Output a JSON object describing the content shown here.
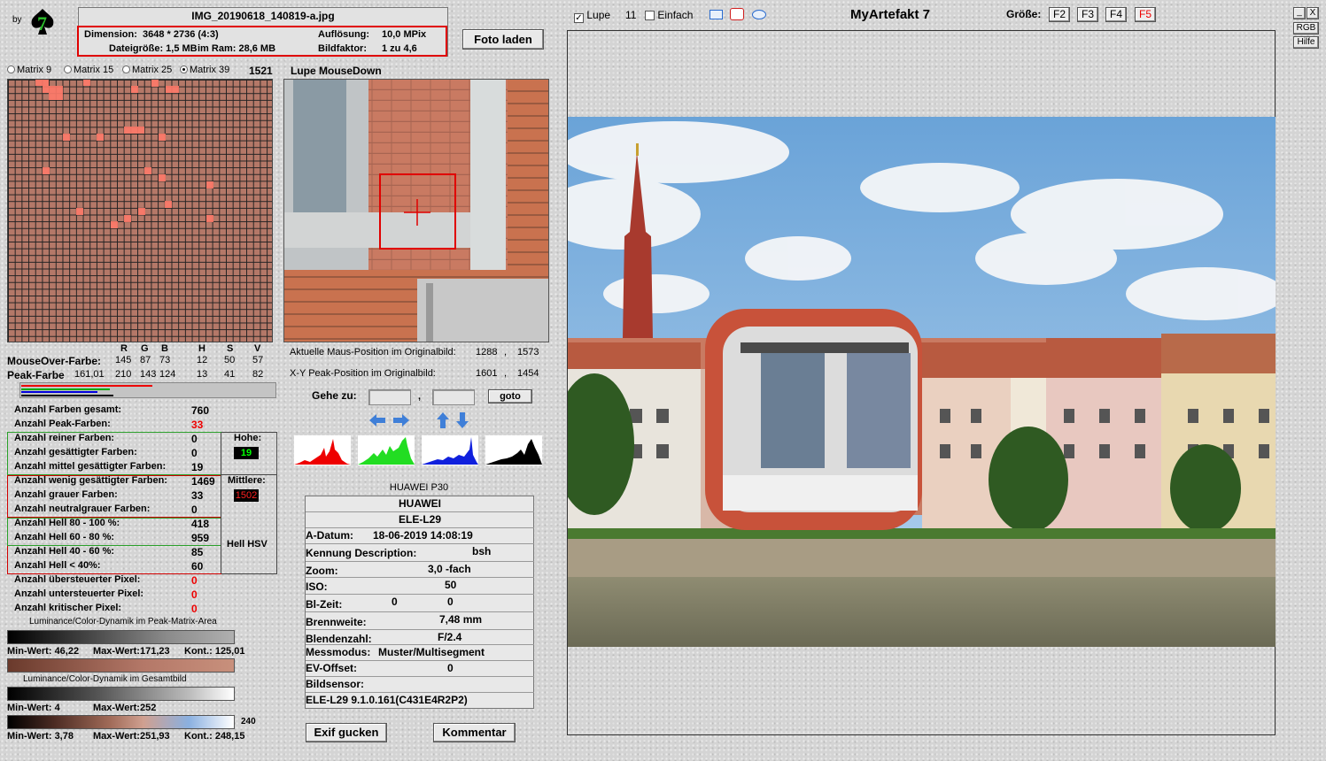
{
  "brand": {
    "by": "by",
    "logo_char": "7"
  },
  "file": {
    "name": "IMG_20190618_140819-a.jpg",
    "dimension_label": "Dimension:",
    "dimension_value": "3648 * 2736 (4:3)",
    "resolution_label": "Auflösung:",
    "resolution_value": "10,0 MPix",
    "filesize_label": "Dateigröße: 1,5 MB",
    "ram_label": "im Ram: 28,6 MB",
    "factor_label": "Bildfaktor:",
    "factor_value": "1 zu 4,6"
  },
  "buttons": {
    "foto_laden": "Foto laden",
    "goto": "goto",
    "exif": "Exif gucken",
    "kommentar": "Kommentar"
  },
  "matrix": {
    "options": [
      "Matrix 9",
      "Matrix 15",
      "Matrix 25",
      "Matrix 39"
    ],
    "selected": "Matrix 39",
    "count": "1521"
  },
  "lupe_title": "Lupe MouseDown",
  "rgb_header": {
    "r": "R",
    "g": "G",
    "b": "B",
    "h": "H",
    "s": "S",
    "v": "V"
  },
  "mouseover": {
    "label": "MouseOver-Farbe:",
    "r": "145",
    "g": "87",
    "b": "73",
    "h": "12",
    "s": "50",
    "v": "57"
  },
  "peak": {
    "label": "Peak-Farbe",
    "extra": "161,01",
    "r": "210",
    "g": "143",
    "b": "124",
    "h": "13",
    "s": "41",
    "v": "82"
  },
  "positions": {
    "mouse_label": "Aktuelle Maus-Position  im Originalbild:",
    "mouse_x": "1288",
    "mouse_y": "1573",
    "peak_label": "X-Y Peak-Position  im Originalbild:",
    "peak_x": "1601",
    "peak_y": "1454",
    "sep": ","
  },
  "goto_label": "Gehe zu:",
  "goto_sep": ",",
  "stats": [
    {
      "label": "Anzahl Farben gesamt:",
      "value": "760"
    },
    {
      "label": "Anzahl Peak-Farben:",
      "value": "33"
    },
    {
      "label": "Anzahl reiner Farben:",
      "value": "0"
    },
    {
      "label": "Anzahl gesättigter Farben:",
      "value": "0"
    },
    {
      "label": "Anzahl mittel gesättigter Farben:",
      "value": "19"
    },
    {
      "label": "Anzahl wenig gesättigter Farben:",
      "value": "1469"
    },
    {
      "label": "Anzahl grauer Farben:",
      "value": "33"
    },
    {
      "label": "Anzahl neutralgrauer Farben:",
      "value": "0"
    },
    {
      "label": "Anzahl Hell 80 - 100 %:",
      "value": "418"
    },
    {
      "label": "Anzahl Hell 60 - 80 %:",
      "value": "959"
    },
    {
      "label": "Anzahl Hell 40 - 60 %:",
      "value": "85"
    },
    {
      "label": "Anzahl Hell < 40%:",
      "value": "60"
    },
    {
      "label": "Anzahl übersteuerter Pixel:",
      "value": "0"
    },
    {
      "label": "Anzahl untersteuerter Pixel:",
      "value": "0"
    },
    {
      "label": "Anzahl kritischer Pixel:",
      "value": "0"
    }
  ],
  "side": {
    "hohe_label": "Hohe:",
    "hohe_value": "19",
    "mittlere_label": "Mittlere:",
    "mittlere_value": "1502",
    "hell_label": "Hell HSV"
  },
  "dynamics": {
    "peak_title": "Luminance/Color-Dynamik im Peak-Matrix-Area",
    "peak_min": "Min-Wert: 46,22",
    "peak_max": "Max-Wert:171,23",
    "peak_kont": "Kont.: 125,01",
    "total_title": "Luminance/Color-Dynamik im Gesamtbild",
    "total_min": "Min-Wert: 4",
    "total_max": "Max-Wert:252",
    "third_side": "240",
    "third_min": "Min-Wert: 3,78",
    "third_max": "Max-Wert:251,93",
    "third_kont": "Kont.: 248,15"
  },
  "exif": {
    "title": "HUAWEI P30",
    "make": "HUAWEI",
    "model": "ELE-L29",
    "rows": [
      {
        "label": "A-Datum:",
        "value": "18-06-2019 14:08:19"
      },
      {
        "label": "Kennung Description:",
        "value": "bsh"
      },
      {
        "label": "Zoom:",
        "value": "3,0 -fach"
      },
      {
        "label": "ISO:",
        "value": "50"
      },
      {
        "label": "Bl-Zeit:",
        "value": "0",
        "value2": "0"
      },
      {
        "label": "Brennweite:",
        "value": "7,48  mm"
      },
      {
        "label": "Blendenzahl:",
        "value": "F/2.4"
      },
      {
        "label": "Messmodus:",
        "value": "Muster/Multisegment"
      },
      {
        "label": "EV-Offset:",
        "value": "0"
      },
      {
        "label": "Bildsensor:",
        "value": ""
      }
    ],
    "firmware": "ELE-L29 9.1.0.161(C431E4R2P2)"
  },
  "toolbar": {
    "lupe_label": "Lupe",
    "lupe_checked": true,
    "lupe_size": "11",
    "einfach_label": "Einfach",
    "einfach_checked": false,
    "app_title": "MyArtefakt 7",
    "size_label": "Größe:",
    "sizes": [
      "F2",
      "F3",
      "F4",
      "F5"
    ],
    "active_size": "F5"
  },
  "window_buttons": {
    "minimize": "_",
    "close": "X",
    "rgb": "RGB",
    "help": "Hilfe"
  },
  "colors": {
    "accent_red": "#e00000",
    "hohe_bg": "#000000",
    "hohe_fg": "#00ff00",
    "mittlere_bg": "#000000",
    "mittlere_fg": "#ff2020"
  }
}
